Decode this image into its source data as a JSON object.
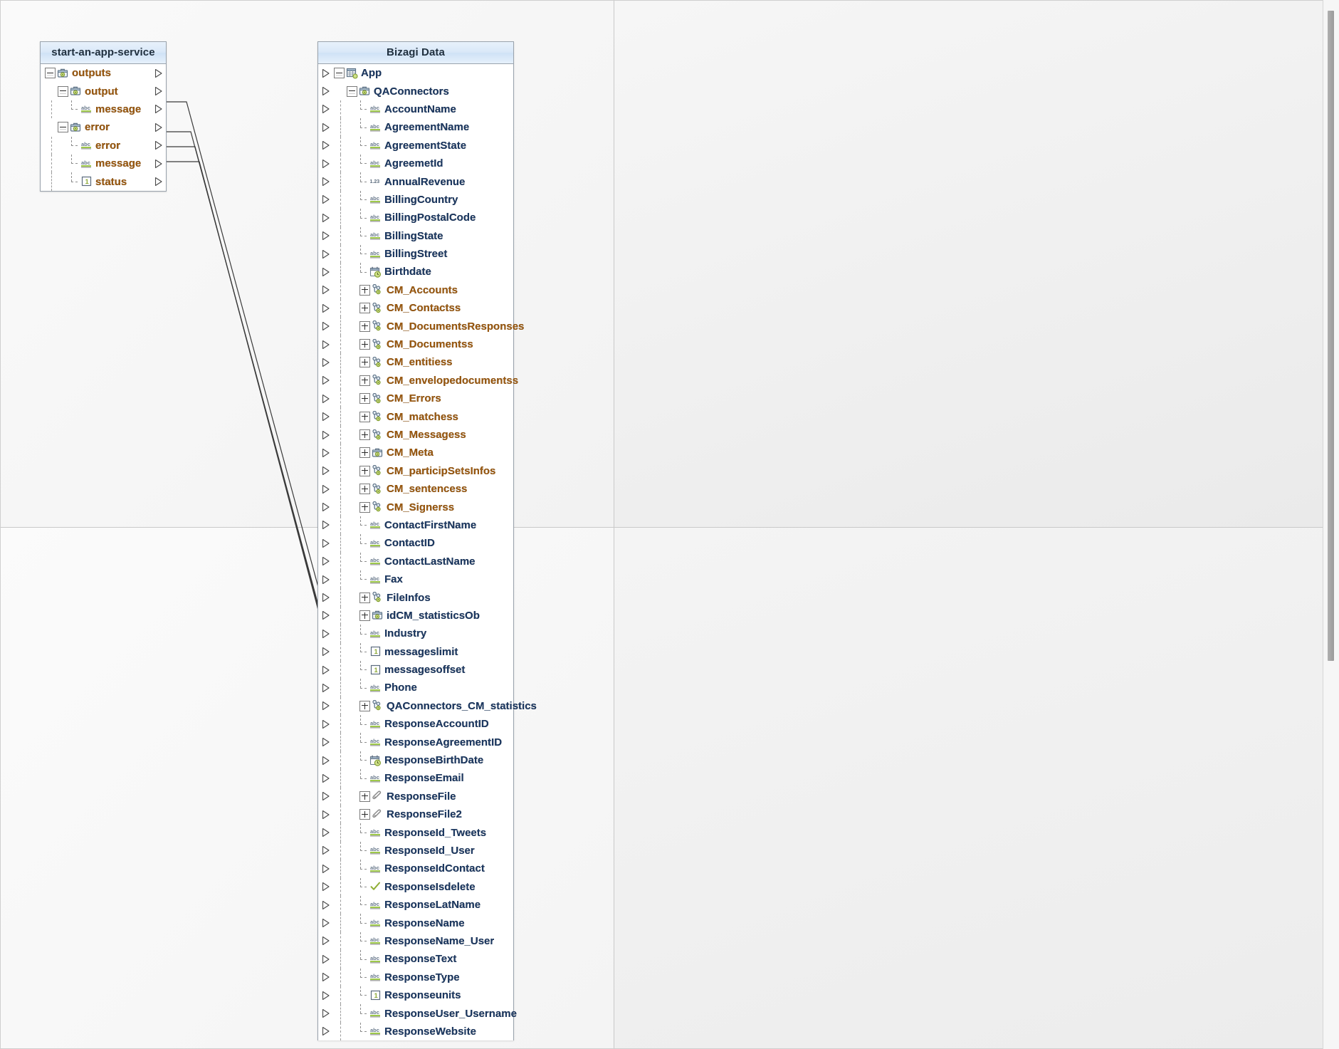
{
  "window": {
    "scrollbar": {
      "name": "vertical-scrollbar",
      "thumb_top_pct": 1,
      "thumb_height_pct": 62
    }
  },
  "left_panel": {
    "title": "start-an-app-service",
    "rows": [
      {
        "label": "outputs",
        "icon": "briefcase-icon",
        "toggle": "minus",
        "depth": 0,
        "color": "orange",
        "arrow": true,
        "linked": false
      },
      {
        "label": "output",
        "icon": "briefcase-icon",
        "toggle": "minus",
        "depth": 1,
        "color": "orange",
        "arrow": true,
        "linked": false
      },
      {
        "label": "message",
        "icon": "abc-icon",
        "toggle": "none",
        "depth": 2,
        "color": "orange",
        "arrow": true,
        "linked": true
      },
      {
        "label": "error",
        "icon": "briefcase-icon",
        "toggle": "minus",
        "depth": 1,
        "color": "orange",
        "arrow": true,
        "linked": false
      },
      {
        "label": "error",
        "icon": "abc-icon",
        "toggle": "none",
        "depth": 2,
        "color": "orange",
        "arrow": true,
        "linked": true
      },
      {
        "label": "message",
        "icon": "abc-icon",
        "toggle": "none",
        "depth": 2,
        "color": "orange",
        "arrow": true,
        "linked": true
      },
      {
        "label": "status",
        "icon": "integer-icon",
        "toggle": "none",
        "depth": 2,
        "color": "orange",
        "arrow": true,
        "linked": true
      }
    ]
  },
  "right_panel": {
    "title": "Bizagi Data",
    "rows": [
      {
        "label": "App",
        "icon": "table-icon",
        "toggle": "minus",
        "depth": 0,
        "color": "blue"
      },
      {
        "label": "QAConnectors",
        "icon": "briefcase-icon",
        "toggle": "minus",
        "depth": 1,
        "color": "blue"
      },
      {
        "label": "AccountName",
        "icon": "abc-icon",
        "toggle": "none",
        "depth": 2,
        "color": "blue"
      },
      {
        "label": "AgreementName",
        "icon": "abc-icon",
        "toggle": "none",
        "depth": 2,
        "color": "blue"
      },
      {
        "label": "AgreementState",
        "icon": "abc-icon",
        "toggle": "none",
        "depth": 2,
        "color": "blue"
      },
      {
        "label": "AgreemetId",
        "icon": "abc-icon",
        "toggle": "none",
        "depth": 2,
        "color": "blue"
      },
      {
        "label": "AnnualRevenue",
        "icon": "decimal-icon",
        "toggle": "none",
        "depth": 2,
        "color": "blue"
      },
      {
        "label": "BillingCountry",
        "icon": "abc-icon",
        "toggle": "none",
        "depth": 2,
        "color": "blue"
      },
      {
        "label": "BillingPostalCode",
        "icon": "abc-icon",
        "toggle": "none",
        "depth": 2,
        "color": "blue"
      },
      {
        "label": "BillingState",
        "icon": "abc-icon",
        "toggle": "none",
        "depth": 2,
        "color": "blue"
      },
      {
        "label": "BillingStreet",
        "icon": "abc-icon",
        "toggle": "none",
        "depth": 2,
        "color": "blue"
      },
      {
        "label": "Birthdate",
        "icon": "datetime-icon",
        "toggle": "none",
        "depth": 2,
        "color": "blue"
      },
      {
        "label": "CM_Accounts",
        "icon": "collection-icon",
        "toggle": "plus",
        "depth": 2,
        "color": "orange"
      },
      {
        "label": "CM_Contactss",
        "icon": "collection-icon",
        "toggle": "plus",
        "depth": 2,
        "color": "orange"
      },
      {
        "label": "CM_DocumentsResponses",
        "icon": "collection-icon",
        "toggle": "plus",
        "depth": 2,
        "color": "orange"
      },
      {
        "label": "CM_Documentss",
        "icon": "collection-icon",
        "toggle": "plus",
        "depth": 2,
        "color": "orange"
      },
      {
        "label": "CM_entitiess",
        "icon": "collection-icon",
        "toggle": "plus",
        "depth": 2,
        "color": "orange"
      },
      {
        "label": "CM_envelopedocumentss",
        "icon": "collection-icon",
        "toggle": "plus",
        "depth": 2,
        "color": "orange"
      },
      {
        "label": "CM_Errors",
        "icon": "collection-icon",
        "toggle": "plus",
        "depth": 2,
        "color": "orange"
      },
      {
        "label": "CM_matchess",
        "icon": "collection-icon",
        "toggle": "plus",
        "depth": 2,
        "color": "orange"
      },
      {
        "label": "CM_Messagess",
        "icon": "collection-icon",
        "toggle": "plus",
        "depth": 2,
        "color": "orange"
      },
      {
        "label": "CM_Meta",
        "icon": "briefcase-icon",
        "toggle": "plus",
        "depth": 2,
        "color": "orange"
      },
      {
        "label": "CM_participSetsInfos",
        "icon": "collection-icon",
        "toggle": "plus",
        "depth": 2,
        "color": "orange"
      },
      {
        "label": "CM_sentencess",
        "icon": "collection-icon",
        "toggle": "plus",
        "depth": 2,
        "color": "orange"
      },
      {
        "label": "CM_Signerss",
        "icon": "collection-icon",
        "toggle": "plus",
        "depth": 2,
        "color": "orange"
      },
      {
        "label": "ContactFirstName",
        "icon": "abc-icon",
        "toggle": "none",
        "depth": 2,
        "color": "blue"
      },
      {
        "label": "ContactID",
        "icon": "abc-icon",
        "toggle": "none",
        "depth": 2,
        "color": "blue"
      },
      {
        "label": "ContactLastName",
        "icon": "abc-icon",
        "toggle": "none",
        "depth": 2,
        "color": "blue"
      },
      {
        "label": "Fax",
        "icon": "abc-icon",
        "toggle": "none",
        "depth": 2,
        "color": "blue"
      },
      {
        "label": "FileInfos",
        "icon": "collection-icon",
        "toggle": "plus",
        "depth": 2,
        "color": "blue"
      },
      {
        "label": "idCM_statisticsOb",
        "icon": "briefcase-icon",
        "toggle": "plus",
        "depth": 2,
        "color": "blue"
      },
      {
        "label": "Industry",
        "icon": "abc-icon",
        "toggle": "none",
        "depth": 2,
        "color": "blue"
      },
      {
        "label": "messageslimit",
        "icon": "integer-icon",
        "toggle": "none",
        "depth": 2,
        "color": "blue"
      },
      {
        "label": "messagesoffset",
        "icon": "integer-icon",
        "toggle": "none",
        "depth": 2,
        "color": "blue"
      },
      {
        "label": "Phone",
        "icon": "abc-icon",
        "toggle": "none",
        "depth": 2,
        "color": "blue"
      },
      {
        "label": "QAConnectors_CM_statistics",
        "icon": "collection-icon",
        "toggle": "plus",
        "depth": 2,
        "color": "blue"
      },
      {
        "label": "ResponseAccountID",
        "icon": "abc-icon",
        "toggle": "none",
        "depth": 2,
        "color": "blue"
      },
      {
        "label": "ResponseAgreementID",
        "icon": "abc-icon",
        "toggle": "none",
        "depth": 2,
        "color": "blue"
      },
      {
        "label": "ResponseBirthDate",
        "icon": "datetime-icon",
        "toggle": "none",
        "depth": 2,
        "color": "blue"
      },
      {
        "label": "ResponseEmail",
        "icon": "abc-icon",
        "toggle": "none",
        "depth": 2,
        "color": "blue"
      },
      {
        "label": "ResponseFile",
        "icon": "attachment-icon",
        "toggle": "plus",
        "depth": 2,
        "color": "blue"
      },
      {
        "label": "ResponseFile2",
        "icon": "attachment-icon",
        "toggle": "plus",
        "depth": 2,
        "color": "blue"
      },
      {
        "label": "ResponseId_Tweets",
        "icon": "abc-icon",
        "toggle": "none",
        "depth": 2,
        "color": "blue"
      },
      {
        "label": "ResponseId_User",
        "icon": "abc-icon",
        "toggle": "none",
        "depth": 2,
        "color": "blue"
      },
      {
        "label": "ResponseIdContact",
        "icon": "abc-icon",
        "toggle": "none",
        "depth": 2,
        "color": "blue"
      },
      {
        "label": "ResponseIsdelete",
        "icon": "boolean-icon",
        "toggle": "none",
        "depth": 2,
        "color": "blue"
      },
      {
        "label": "ResponseLatName",
        "icon": "abc-icon",
        "toggle": "none",
        "depth": 2,
        "color": "blue"
      },
      {
        "label": "ResponseName",
        "icon": "abc-icon",
        "toggle": "none",
        "depth": 2,
        "color": "blue"
      },
      {
        "label": "ResponseName_User",
        "icon": "abc-icon",
        "toggle": "none",
        "depth": 2,
        "color": "blue"
      },
      {
        "label": "ResponseText",
        "icon": "abc-icon",
        "toggle": "none",
        "depth": 2,
        "color": "blue"
      },
      {
        "label": "ResponseType",
        "icon": "abc-icon",
        "toggle": "none",
        "depth": 2,
        "color": "blue"
      },
      {
        "label": "Responseunits",
        "icon": "integer-icon",
        "toggle": "none",
        "depth": 2,
        "color": "blue"
      },
      {
        "label": "ResponseUser_Username",
        "icon": "abc-icon",
        "toggle": "none",
        "depth": 2,
        "color": "blue"
      },
      {
        "label": "ResponseWebsite",
        "icon": "abc-icon",
        "toggle": "none",
        "depth": 2,
        "color": "blue"
      }
    ]
  },
  "mappings": [
    {
      "from": "message",
      "to": "ResponseName"
    },
    {
      "from": "error",
      "to": "ResponseText"
    },
    {
      "from": "message",
      "to": "ResponseType"
    },
    {
      "from": "status",
      "to": "Responseunits"
    }
  ],
  "colors": {
    "title_bar": "#d9e8f8",
    "panel_border": "#9aa3ad",
    "label_orange": "#9c5a10",
    "label_blue": "#1e3a63",
    "link_line": "#3a3a3a",
    "canvas": "#f2f2f2"
  }
}
